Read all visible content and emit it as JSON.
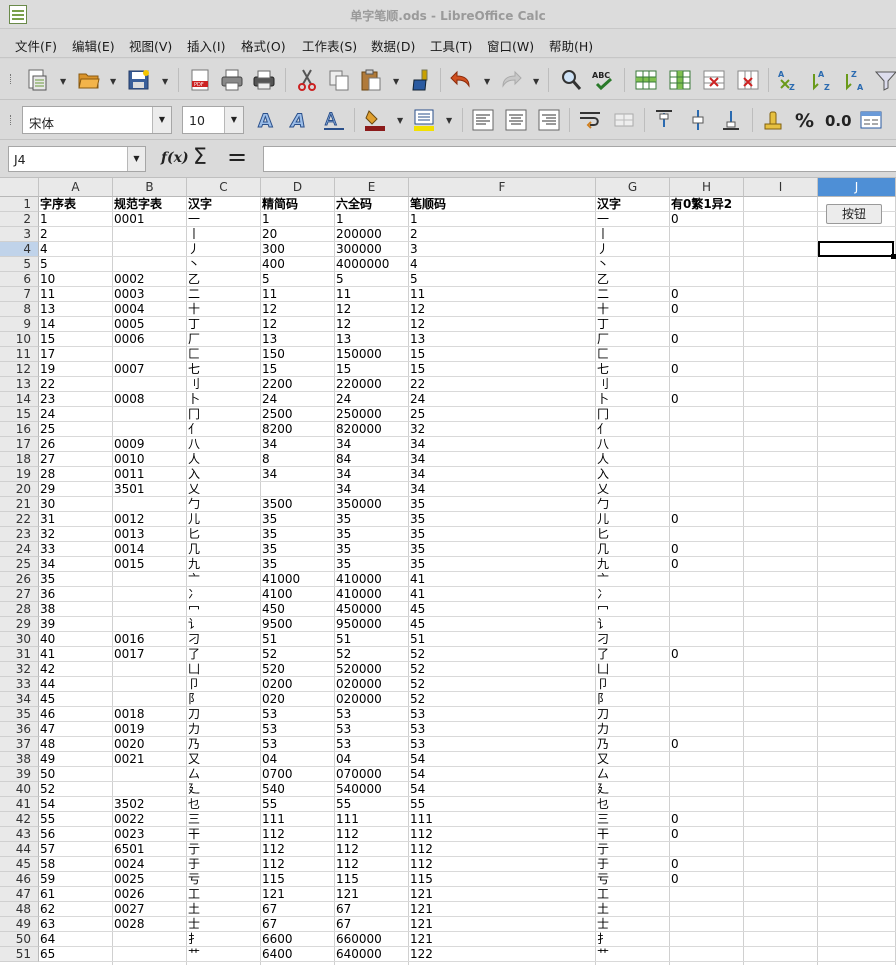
{
  "window": {
    "title": "单字笔顺.ods - LibreOffice Calc"
  },
  "menu": [
    "文件(F)",
    "编辑(E)",
    "视图(V)",
    "插入(I)",
    "格式(O)",
    "工作表(S)",
    "数据(D)",
    "工具(T)",
    "窗口(W)",
    "帮助(H)"
  ],
  "toolbar1": {
    "icons": [
      "new-document-icon",
      "open-folder-icon",
      "save-icon",
      "export-pdf-icon",
      "print-icon",
      "print-preview-icon",
      "cut-icon",
      "copy-icon",
      "paste-icon",
      "clone-formatting-icon",
      "undo-icon",
      "redo-icon",
      "find-replace-icon",
      "spellcheck-icon",
      "row-icon",
      "column-icon",
      "delete-row-icon",
      "delete-column-icon",
      "sort-icon",
      "sort-ascending-icon",
      "sort-descending-icon",
      "autofilter-icon"
    ]
  },
  "toolbar2": {
    "font_name": "宋体",
    "font_size": "10",
    "percent": "%",
    "decimal": "0.0",
    "icons": [
      "bold-a-icon",
      "italic-a-icon",
      "underline-a-icon",
      "background-color-icon",
      "font-color-icon",
      "align-left-icon",
      "align-center-icon",
      "align-right-icon",
      "wrap-text-icon",
      "merge-cells-icon",
      "align-top-icon",
      "center-vertically-icon",
      "align-bottom-icon",
      "currency-icon",
      "number-format-icon"
    ]
  },
  "formula_bar": {
    "name_box": "J4",
    "fx": "f(x)",
    "sigma": "Σ",
    "equals": "=",
    "content": ""
  },
  "columns": [
    "A",
    "B",
    "C",
    "D",
    "E",
    "F",
    "G",
    "H",
    "I",
    "J"
  ],
  "selected_column": "J",
  "selected_row": "4",
  "button_label": "按钮",
  "rows": [
    [
      "字序表",
      "规范字表",
      "汉字",
      "精简码",
      "六全码",
      "笔顺码",
      "汉字",
      "有0繁1异2"
    ],
    [
      "1",
      "0001",
      "一",
      "1",
      "1",
      "1",
      "一",
      "0"
    ],
    [
      "2",
      "",
      "丨",
      "20",
      "200000",
      "2",
      "丨",
      ""
    ],
    [
      "4",
      "",
      "丿",
      "300",
      "300000",
      "3",
      "丿",
      ""
    ],
    [
      "5",
      "",
      "丶",
      "400",
      "4000000",
      "4",
      "丶",
      ""
    ],
    [
      "10",
      "0002",
      "乙",
      "5",
      "5",
      "5",
      "乙",
      ""
    ],
    [
      "11",
      "0003",
      "二",
      "11",
      "11",
      "11",
      "二",
      "0"
    ],
    [
      "13",
      "0004",
      "十",
      "12",
      "12",
      "12",
      "十",
      "0"
    ],
    [
      "14",
      "0005",
      "丁",
      "12",
      "12",
      "12",
      "丁",
      ""
    ],
    [
      "15",
      "0006",
      "厂",
      "13",
      "13",
      "13",
      "厂",
      "0"
    ],
    [
      "17",
      "",
      "匚",
      "150",
      "150000",
      "15",
      "匚",
      ""
    ],
    [
      "19",
      "0007",
      "七",
      "15",
      "15",
      "15",
      "七",
      "0"
    ],
    [
      "22",
      "",
      "刂",
      "2200",
      "220000",
      "22",
      "刂",
      ""
    ],
    [
      "23",
      "0008",
      "卜",
      "24",
      "24",
      "24",
      "卜",
      "0"
    ],
    [
      "24",
      "",
      "冂",
      "2500",
      "250000",
      "25",
      "冂",
      ""
    ],
    [
      "25",
      "",
      "亻",
      "8200",
      "820000",
      "32",
      "亻",
      ""
    ],
    [
      "26",
      "0009",
      "八",
      "34",
      "34",
      "34",
      "八",
      ""
    ],
    [
      "27",
      "0010",
      "人",
      "8",
      "84",
      "34",
      "人",
      ""
    ],
    [
      "28",
      "0011",
      "入",
      "34",
      "34",
      "34",
      "入",
      ""
    ],
    [
      "29",
      "3501",
      "乂",
      "",
      "34",
      "34",
      "乂",
      ""
    ],
    [
      "30",
      "",
      "勹",
      "3500",
      "350000",
      "35",
      "勹",
      ""
    ],
    [
      "31",
      "0012",
      "儿",
      "35",
      "35",
      "35",
      "儿",
      "0"
    ],
    [
      "32",
      "0013",
      "匕",
      "35",
      "35",
      "35",
      "匕",
      ""
    ],
    [
      "33",
      "0014",
      "几",
      "35",
      "35",
      "35",
      "几",
      "0"
    ],
    [
      "34",
      "0015",
      "九",
      "35",
      "35",
      "35",
      "九",
      "0"
    ],
    [
      "35",
      "",
      "亠",
      "41000",
      "410000",
      "41",
      "亠",
      ""
    ],
    [
      "36",
      "",
      "冫",
      "4100",
      "410000",
      "41",
      "冫",
      ""
    ],
    [
      "38",
      "",
      "冖",
      "450",
      "450000",
      "45",
      "冖",
      ""
    ],
    [
      "39",
      "",
      "讠",
      "9500",
      "950000",
      "45",
      "讠",
      ""
    ],
    [
      "40",
      "0016",
      "刁",
      "51",
      "51",
      "51",
      "刁",
      ""
    ],
    [
      "41",
      "0017",
      "了",
      "52",
      "52",
      "52",
      "了",
      "0"
    ],
    [
      "42",
      "",
      "凵",
      "520",
      "520000",
      "52",
      "凵",
      ""
    ],
    [
      "44",
      "",
      "卩",
      "0200",
      "020000",
      "52",
      "卩",
      ""
    ],
    [
      "45",
      "",
      "阝",
      "020",
      "020000",
      "52",
      "阝",
      ""
    ],
    [
      "46",
      "0018",
      "刀",
      "53",
      "53",
      "53",
      "刀",
      ""
    ],
    [
      "47",
      "0019",
      "力",
      "53",
      "53",
      "53",
      "力",
      ""
    ],
    [
      "48",
      "0020",
      "乃",
      "53",
      "53",
      "53",
      "乃",
      "0"
    ],
    [
      "49",
      "0021",
      "又",
      "04",
      "04",
      "54",
      "又",
      ""
    ],
    [
      "50",
      "",
      "厶",
      "0700",
      "070000",
      "54",
      "厶",
      ""
    ],
    [
      "52",
      "",
      "廴",
      "540",
      "540000",
      "54",
      "廴",
      ""
    ],
    [
      "54",
      "3502",
      "乜",
      "55",
      "55",
      "55",
      "乜",
      ""
    ],
    [
      "55",
      "0022",
      "三",
      "111",
      "111",
      "111",
      "三",
      "0"
    ],
    [
      "56",
      "0023",
      "干",
      "112",
      "112",
      "112",
      "干",
      "0"
    ],
    [
      "57",
      "6501",
      "亍",
      "112",
      "112",
      "112",
      "亍",
      ""
    ],
    [
      "58",
      "0024",
      "于",
      "112",
      "112",
      "112",
      "于",
      "0"
    ],
    [
      "59",
      "0025",
      "亏",
      "115",
      "115",
      "115",
      "亏",
      "0"
    ],
    [
      "61",
      "0026",
      "工",
      "121",
      "121",
      "121",
      "工",
      ""
    ],
    [
      "62",
      "0027",
      "土",
      "67",
      "67",
      "121",
      "土",
      ""
    ],
    [
      "63",
      "0028",
      "士",
      "67",
      "67",
      "121",
      "士",
      ""
    ],
    [
      "64",
      "",
      "扌",
      "6600",
      "660000",
      "121",
      "扌",
      ""
    ],
    [
      "65",
      "",
      "艹",
      "6400",
      "640000",
      "122",
      "艹",
      ""
    ]
  ]
}
